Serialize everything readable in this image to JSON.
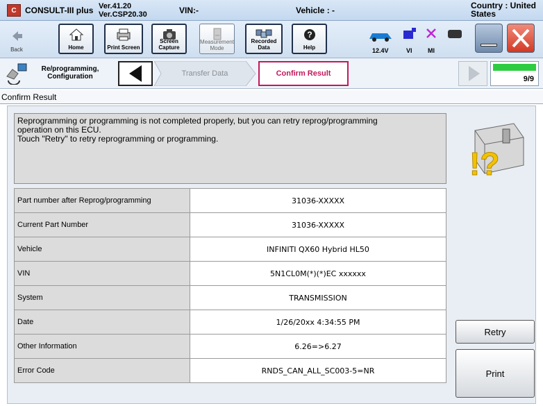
{
  "app": {
    "logo_text": "C-III",
    "title": "CONSULT-III plus",
    "version_line1": "Ver.41.20",
    "version_line2": "Ver.CSP20.30",
    "vin_label": "VIN:-",
    "vehicle_label": "Vehicle : -",
    "country_label": "Country : United States"
  },
  "toolbar": {
    "back": "Back",
    "home": "Home",
    "print_screen": "Print Screen",
    "screen_capture": "Screen Capture",
    "measurement_mode": "Measurement Mode",
    "recorded_data": "Recorded Data",
    "help": "Help",
    "voltage": "12.4V",
    "vi": "VI",
    "mi": "MI"
  },
  "nav": {
    "reprog_label": "Re/programming, Configuration",
    "step_transfer": "Transfer Data",
    "step_confirm": "Confirm Result",
    "page_counter": "9/9"
  },
  "section": {
    "title": "Confirm Result"
  },
  "message": {
    "line1": "Reprogramming or programming is not completed properly, but you can retry reprog/programming",
    "line2": "operation on this ECU.",
    "line3": "Touch \"Retry\" to retry reprogramming or programming."
  },
  "info_rows": [
    {
      "key": "Part number after Reprog/programming",
      "value": "31036-XXXXX"
    },
    {
      "key": "Current Part Number",
      "value": "31036-XXXXX"
    },
    {
      "key": "Vehicle",
      "value": "INFINITI  QX60 Hybrid HL50"
    },
    {
      "key": "VIN",
      "value": "5N1CL0M(*)(*)EC xxxxxx"
    },
    {
      "key": "System",
      "value": "TRANSMISSION"
    },
    {
      "key": "Date",
      "value": "1/26/20xx 4:34:55 PM"
    },
    {
      "key": "Other Information",
      "value": "6.26=>6.27"
    },
    {
      "key": "Error Code",
      "value": "RNDS_CAN_ALL_SC003-5=NR"
    }
  ],
  "buttons": {
    "retry": "Retry",
    "print": "Print"
  },
  "colors": {
    "confirm_border": "#c2185b",
    "battery_green": "#2ecc40",
    "close_red": "#e74c3c"
  }
}
